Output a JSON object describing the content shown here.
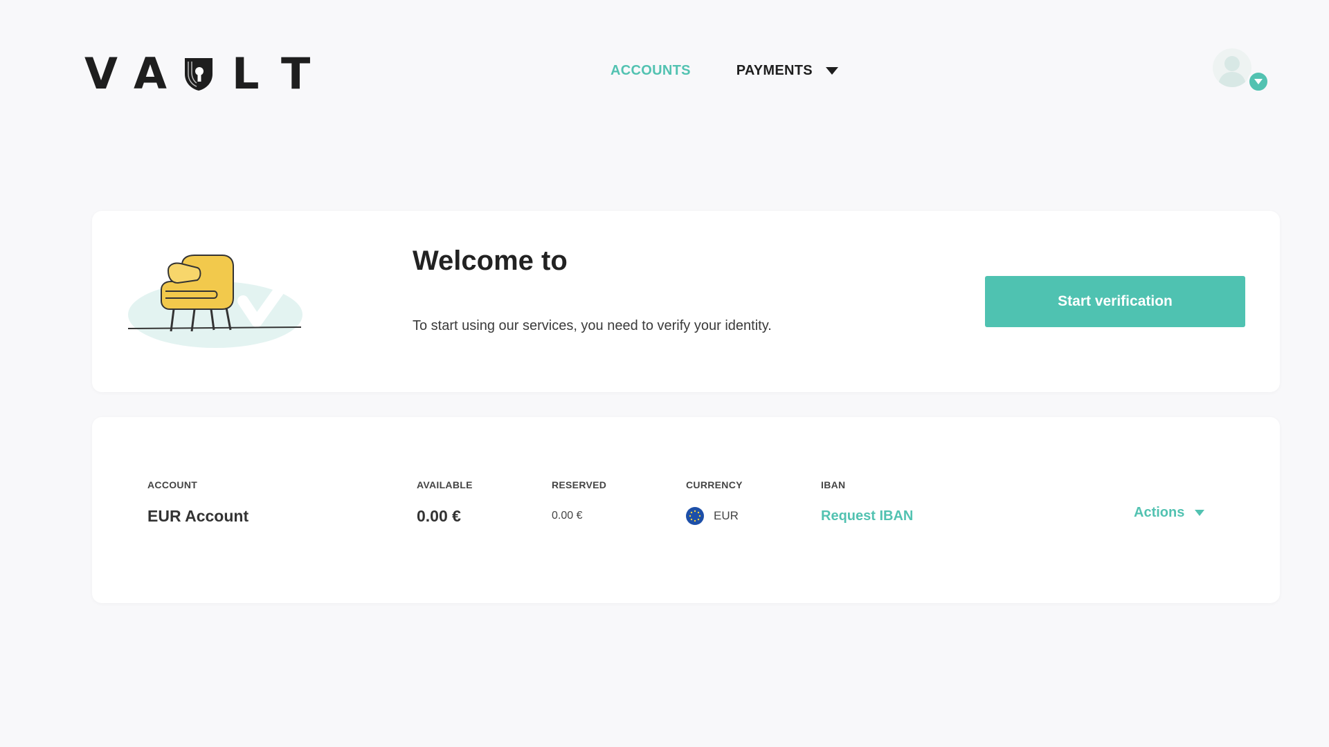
{
  "header": {
    "logo": {
      "letters": [
        "V",
        "A",
        "",
        "L",
        "T"
      ],
      "shield_icon": "shield-keyhole-icon"
    },
    "nav": {
      "accounts_label": "ACCOUNTS",
      "payments_label": "PAYMENTS",
      "payments_caret_icon": "caret-down-icon"
    },
    "user_menu": {
      "avatar_icon": "user-avatar-icon",
      "badge_icon": "chevron-down-icon"
    }
  },
  "welcome": {
    "illustration": "armchair-checkmark-illustration",
    "title": "Welcome to",
    "message": "To start using our services, you need to verify your identity.",
    "button_label": "Start verification"
  },
  "accounts": {
    "columns": {
      "account": "ACCOUNT",
      "available": "AVAILABLE",
      "reserved": "RESERVED",
      "currency": "CURRENCY",
      "iban": "IBAN"
    },
    "rows": [
      {
        "account": "EUR Account",
        "available": "0.00 €",
        "reserved": "0.00 €",
        "currency": "EUR",
        "currency_icon": "eu-flag-icon",
        "iban_action": "Request IBAN",
        "actions_label": "Actions",
        "actions_icon": "caret-down-icon"
      }
    ]
  },
  "colors": {
    "accent": "#52c2b1",
    "button": "#4fc2b1",
    "text_dark": "#1e1e1e",
    "background": "#f8f8fa",
    "card": "#ffffff"
  }
}
